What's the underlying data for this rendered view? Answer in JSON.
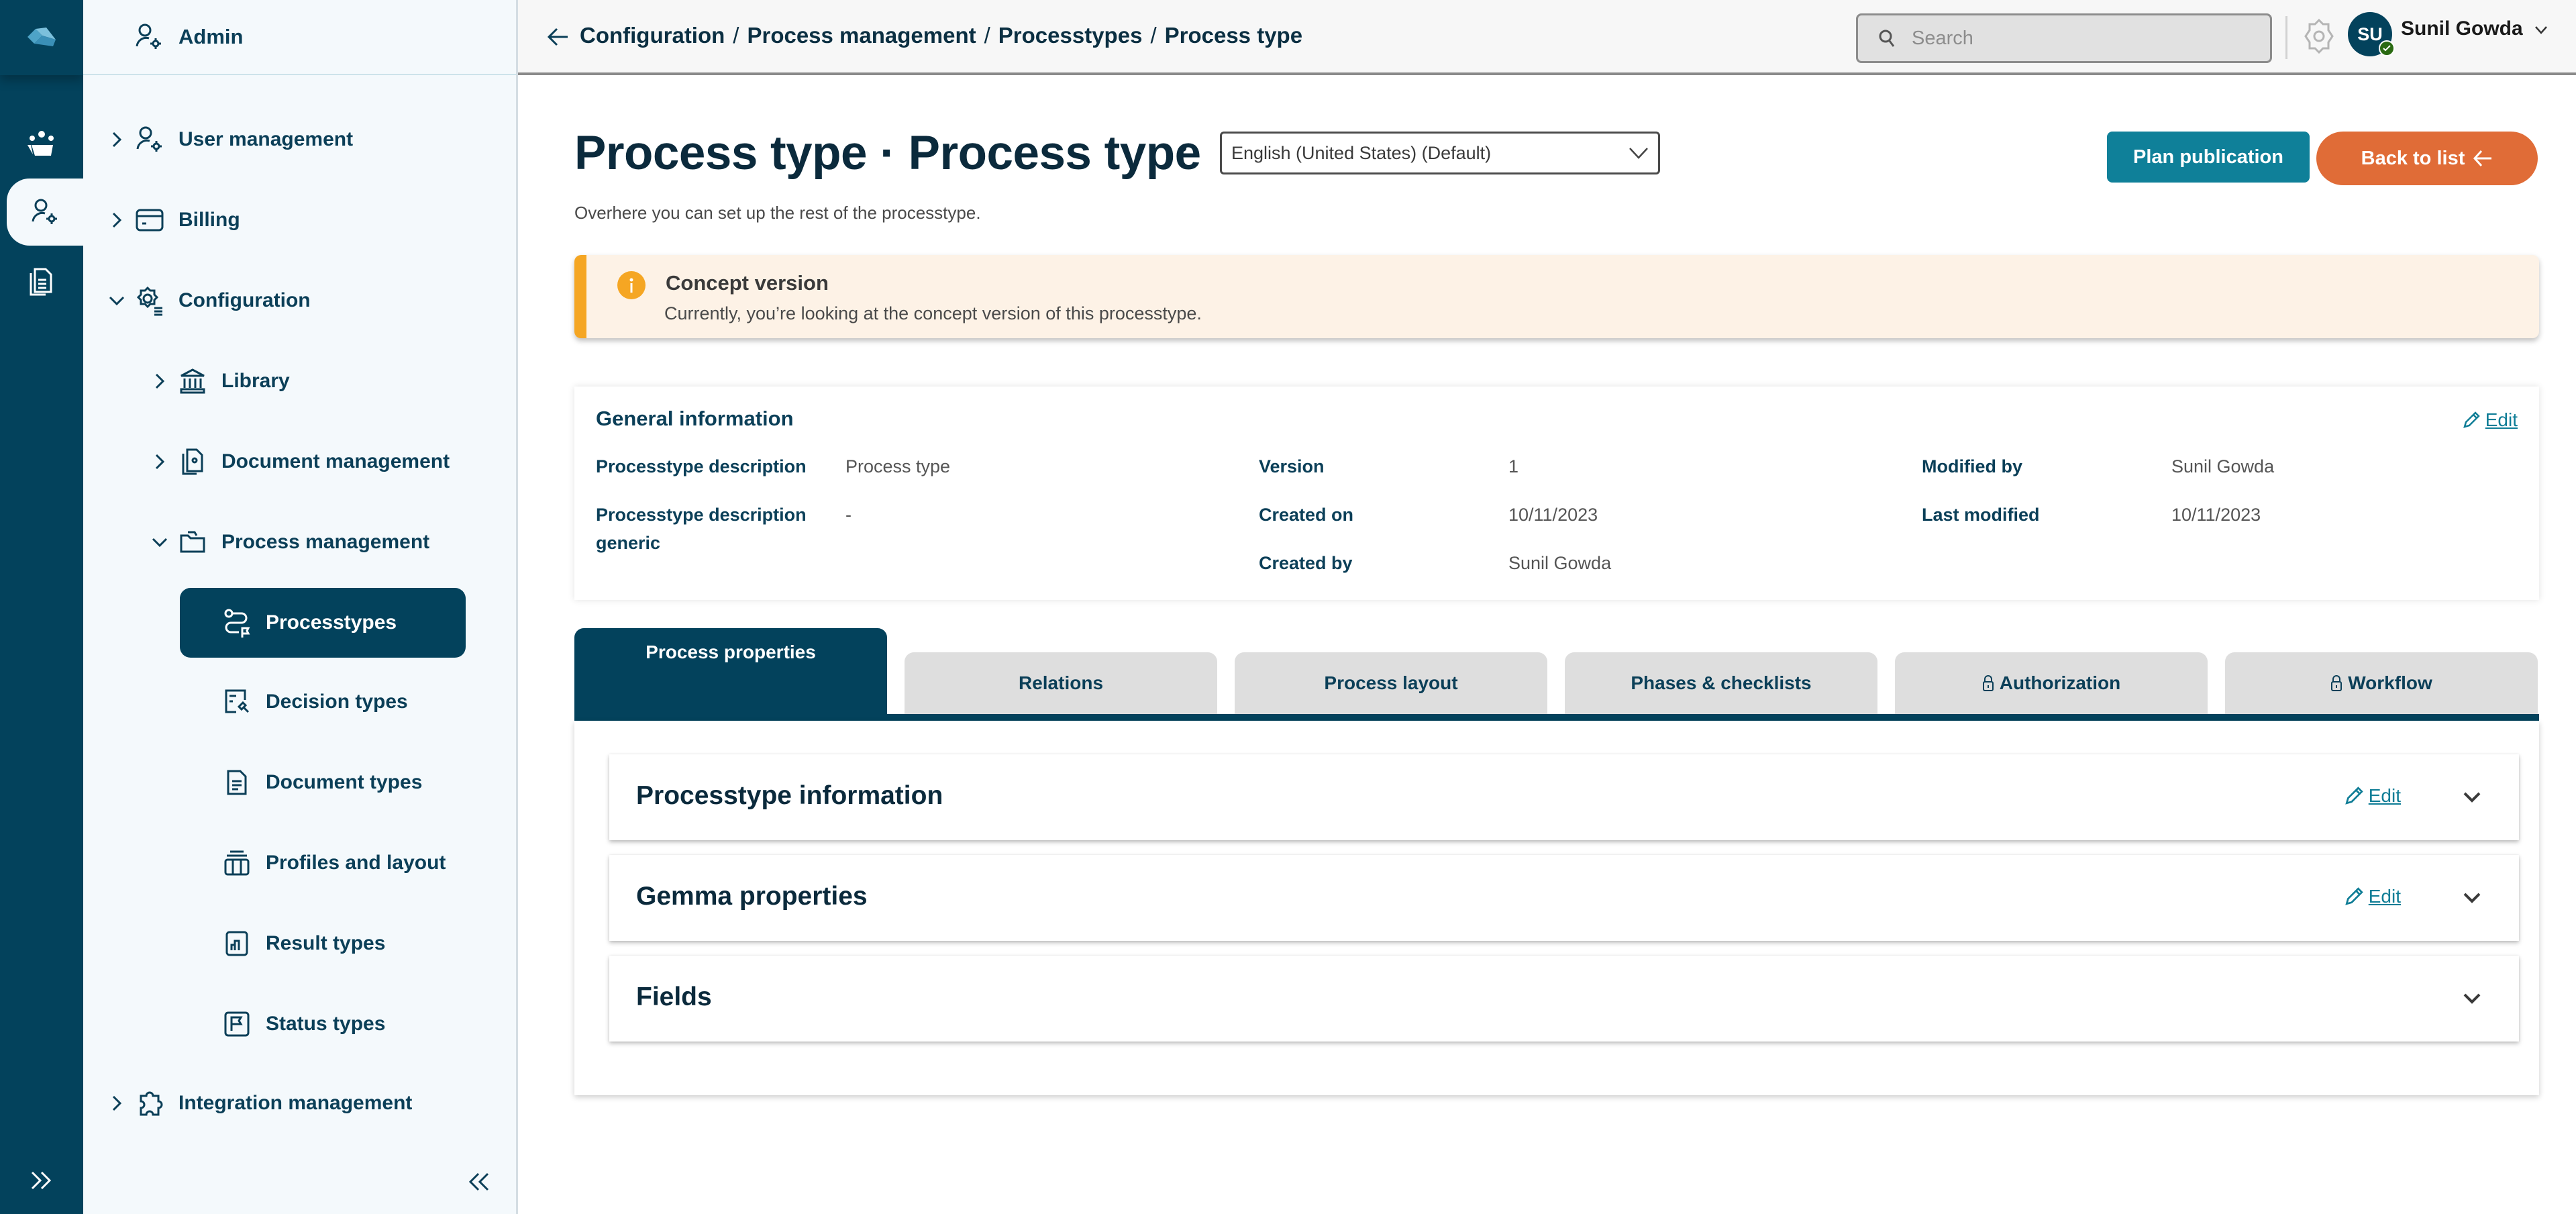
{
  "rail": {
    "items": [
      {
        "name": "logo",
        "icon": "cloud-logo-icon"
      },
      {
        "name": "teams",
        "icon": "team-icon"
      },
      {
        "name": "admin",
        "icon": "user-gear-icon",
        "active": true
      },
      {
        "name": "documents",
        "icon": "documents-icon"
      }
    ],
    "expand_icon": "double-chevron-right-icon"
  },
  "sidebar": {
    "header": "Admin",
    "items": [
      {
        "label": "User management",
        "level": 0,
        "chevron": "right",
        "icon": "user-gear-icon"
      },
      {
        "label": "Billing",
        "level": 0,
        "chevron": "right",
        "icon": "credit-card-icon"
      },
      {
        "label": "Configuration",
        "level": 0,
        "chevron": "down",
        "icon": "gear-list-icon"
      },
      {
        "label": "Library",
        "level": 1,
        "chevron": "right",
        "icon": "library-icon"
      },
      {
        "label": "Document management",
        "level": 1,
        "chevron": "right",
        "icon": "document-gear-icon"
      },
      {
        "label": "Process management",
        "level": 1,
        "chevron": "down",
        "icon": "folder-icon"
      },
      {
        "label": "Processtypes",
        "level": 2,
        "icon": "route-flag-icon",
        "selected": true
      },
      {
        "label": "Decision types",
        "level": 2,
        "icon": "decision-gavel-icon"
      },
      {
        "label": "Document types",
        "level": 2,
        "icon": "document-icon"
      },
      {
        "label": "Profiles and layout",
        "level": 2,
        "icon": "columns-layout-icon"
      },
      {
        "label": "Result types",
        "level": 2,
        "icon": "bar-chart-icon"
      },
      {
        "label": "Status types",
        "level": 2,
        "icon": "flag-square-icon"
      },
      {
        "label": "Integration management",
        "level": 0,
        "chevron": "right",
        "icon": "puzzle-icon"
      }
    ],
    "collapse_icon": "double-chevron-left-icon"
  },
  "topbar": {
    "breadcrumb": [
      "Configuration",
      "Process management",
      "Processtypes",
      "Process type"
    ],
    "breadcrumb_separator": "/",
    "search_placeholder": "Search",
    "user": {
      "initials": "SU",
      "name": "Sunil Gowda",
      "status": "online"
    }
  },
  "page": {
    "title": "Process type · Process type",
    "language": "English (United States) (Default)",
    "subtitle": "Overhere you can set up the rest of the processtype.",
    "plan_publication": "Plan publication",
    "back_to_list": "Back to list",
    "alert": {
      "title": "Concept version",
      "text": "Currently, you’re looking at the concept version of this processtype."
    },
    "general_info": {
      "title": "General information",
      "edit": "Edit",
      "fields": [
        {
          "label": "Processtype description",
          "value": "Process type"
        },
        {
          "label": "Processtype description generic",
          "value": "-"
        },
        {
          "label": "Version",
          "value": "1"
        },
        {
          "label": "Created on",
          "value": "10/11/2023"
        },
        {
          "label": "Created by",
          "value": "Sunil Gowda"
        },
        {
          "label": "Modified by",
          "value": "Sunil Gowda"
        },
        {
          "label": "Last modified",
          "value": "10/11/2023"
        }
      ]
    },
    "tabs": [
      {
        "label": "Process properties",
        "active": true
      },
      {
        "label": "Relations"
      },
      {
        "label": "Process layout"
      },
      {
        "label": "Phases & checklists"
      },
      {
        "label": "Authorization",
        "locked": true
      },
      {
        "label": "Workflow",
        "locked": true
      }
    ],
    "accordions": [
      {
        "title": "Processtype information",
        "edit": "Edit"
      },
      {
        "title": "Gemma properties",
        "edit": "Edit"
      },
      {
        "title": "Fields"
      }
    ]
  },
  "colors": {
    "primary_dark": "#03425c",
    "teal": "#0f8099",
    "orange": "#e06c37",
    "warning": "#f5a623",
    "sidebar_bg": "#f4f9fc"
  }
}
